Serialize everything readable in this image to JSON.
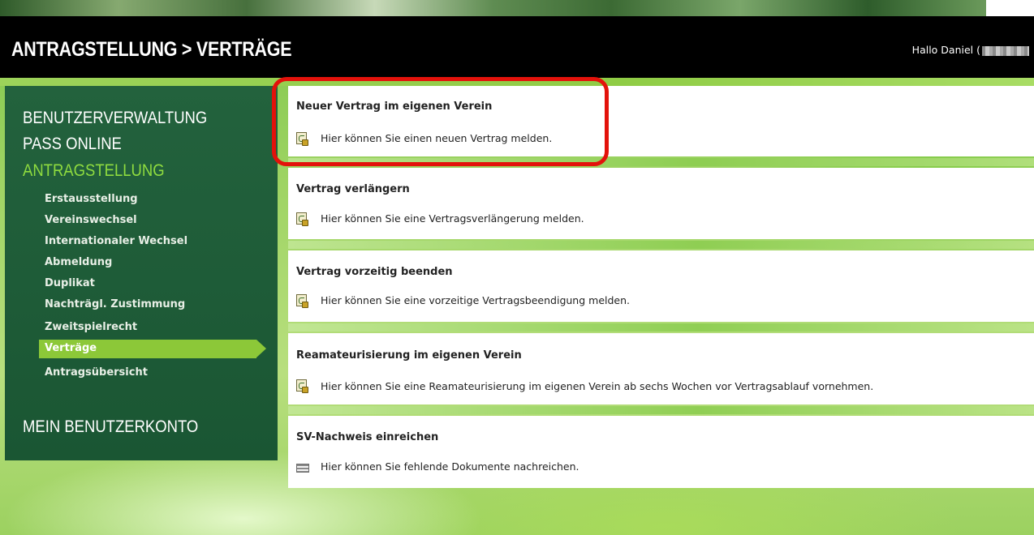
{
  "header": {
    "title": "ANTRAGSTELLUNG > VERTRÄGE",
    "greeting": "Hallo Daniel ("
  },
  "sidebar": {
    "sections": [
      {
        "label": "BENUTZERVERWALTUNG"
      },
      {
        "label": "PASS ONLINE"
      },
      {
        "label": "ANTRAGSTELLUNG"
      },
      {
        "label": "MEIN BENUTZERKONTO"
      }
    ],
    "sub_items": [
      {
        "label": "Erstausstellung"
      },
      {
        "label": "Vereinswechsel"
      },
      {
        "label": "Internationaler Wechsel"
      },
      {
        "label": "Abmeldung"
      },
      {
        "label": "Duplikat"
      },
      {
        "label": "Nachträgl. Zustimmung"
      },
      {
        "label": "Zweitspielrecht"
      },
      {
        "label": "Verträge"
      },
      {
        "label": "Antragsübersicht"
      }
    ],
    "active_sub_item": "Verträge"
  },
  "panels": [
    {
      "title": "Neuer Vertrag im eigenen Verein",
      "text": "Hier können Sie einen neuen Vertrag melden.",
      "icon": "document-contract-icon"
    },
    {
      "title": "Vertrag verlängern",
      "text": "Hier können Sie eine Vertragsverlängerung melden.",
      "icon": "document-contract-icon"
    },
    {
      "title": "Vertrag vorzeitig beenden",
      "text": "Hier können Sie eine vorzeitige Vertragsbeendigung melden.",
      "icon": "document-contract-icon"
    },
    {
      "title": "Reamateurisierung im eigenen Verein",
      "text": "Hier können Sie eine Reamateurisierung im eigenen Verein ab sechs Wochen vor Vertragsablauf vornehmen.",
      "icon": "document-contract-icon"
    },
    {
      "title": "SV-Nachweis einreichen",
      "text": "Hier können Sie fehlende Dokumente nachreichen.",
      "icon": "list-document-icon"
    }
  ],
  "colors": {
    "header_bg": "#000000",
    "sidebar_bg": "#1f5c38",
    "active_section": "#8fdc3f",
    "active_item_bg": "#8cc838",
    "highlight": "#e3120b"
  }
}
